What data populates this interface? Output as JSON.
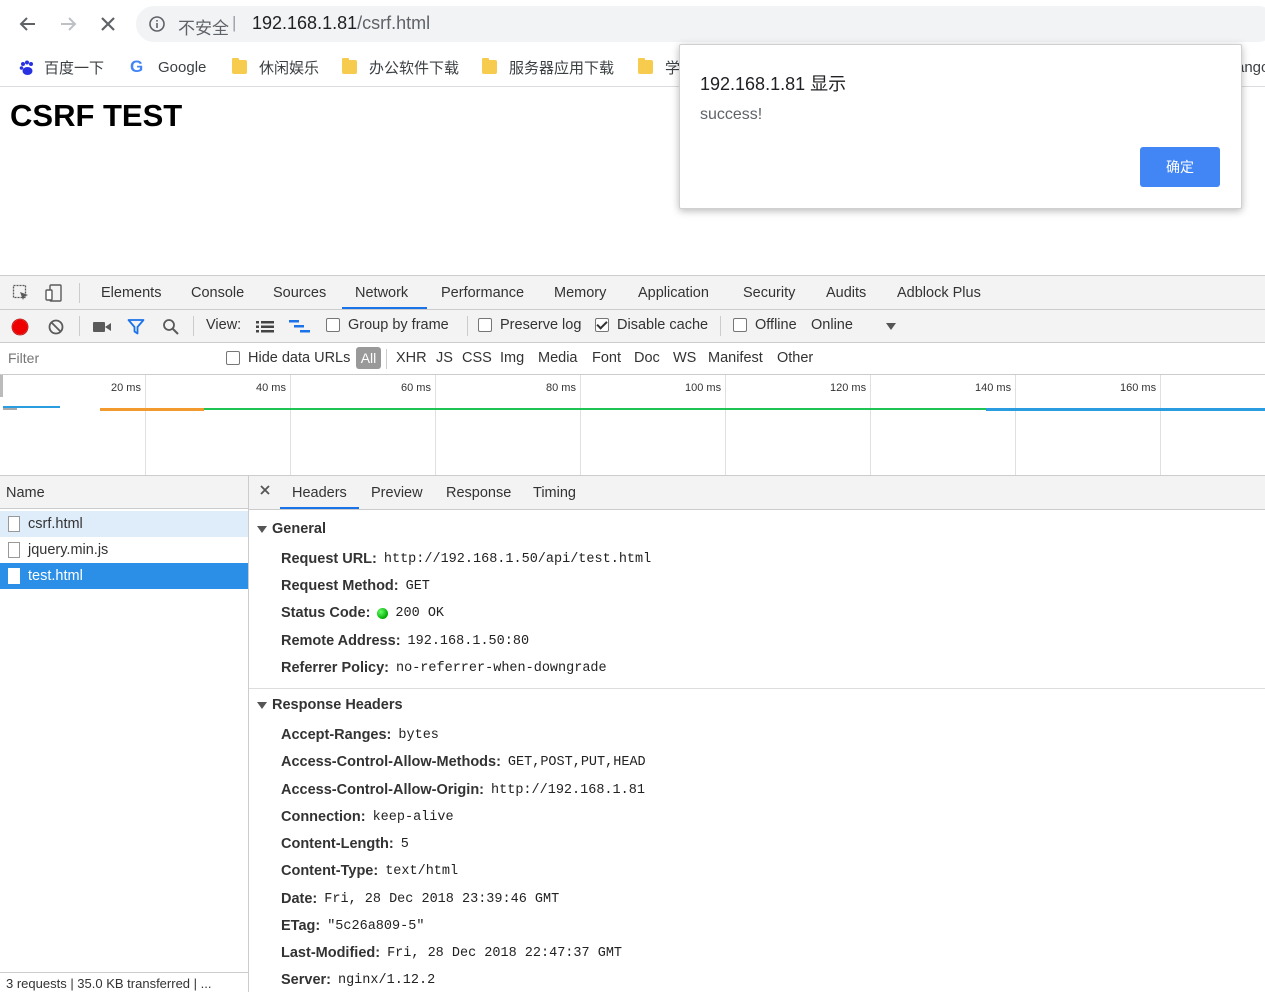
{
  "browser": {
    "security_label": "不安全",
    "separator": "|",
    "url_host": "192.168.1.81",
    "url_path": "/csrf.html",
    "bookmarks": [
      {
        "label": "百度一下",
        "icon": "baidu-paw-icon"
      },
      {
        "label": "Google",
        "icon": "google-g-icon"
      },
      {
        "label": "休闲娱乐",
        "icon": "folder-icon"
      },
      {
        "label": "办公软件下载",
        "icon": "folder-icon"
      },
      {
        "label": "服务器应用下载",
        "icon": "folder-icon"
      },
      {
        "label": "学",
        "icon": "folder-icon"
      },
      {
        "label": "ango",
        "icon": ""
      }
    ]
  },
  "page": {
    "heading": "CSRF TEST"
  },
  "alert": {
    "title": "192.168.1.81 显示",
    "message": "success!",
    "ok_label": "确定",
    "button_color": "#4285f4"
  },
  "devtools": {
    "tabs": [
      "Elements",
      "Console",
      "Sources",
      "Network",
      "Performance",
      "Memory",
      "Application",
      "Security",
      "Audits",
      "Adblock Plus"
    ],
    "active_tab": "Network",
    "toolbar": {
      "view_label": "View:",
      "group_by_frame": "Group by frame",
      "group_by_frame_checked": false,
      "preserve_log": "Preserve log",
      "preserve_log_checked": false,
      "disable_cache": "Disable cache",
      "disable_cache_checked": true,
      "offline": "Offline",
      "offline_checked": false,
      "throttle": "Online"
    },
    "filter": {
      "placeholder": "Filter",
      "hide_data_urls": "Hide data URLs",
      "types": [
        "All",
        "XHR",
        "JS",
        "CSS",
        "Img",
        "Media",
        "Font",
        "Doc",
        "WS",
        "Manifest",
        "Other"
      ],
      "active_type": "All"
    },
    "timeline": {
      "ticks": [
        "20 ms",
        "40 ms",
        "60 ms",
        "80 ms",
        "100 ms",
        "120 ms",
        "140 ms",
        "160 ms"
      ]
    },
    "name_column_header": "Name",
    "requests": [
      {
        "name": "csrf.html",
        "state": "highlighted"
      },
      {
        "name": "jquery.min.js",
        "state": "normal"
      },
      {
        "name": "test.html",
        "state": "selected"
      }
    ],
    "status_bar": "3 requests | 35.0 KB transferred | ...",
    "detail_tabs": [
      "Headers",
      "Preview",
      "Response",
      "Timing"
    ],
    "active_detail_tab": "Headers",
    "general_title": "General",
    "general": [
      {
        "key": "Request URL:",
        "value": "http://192.168.1.50/api/test.html"
      },
      {
        "key": "Request Method:",
        "value": "GET"
      },
      {
        "key": "Status Code:",
        "value": "200 OK",
        "status_color": "#00aa00"
      },
      {
        "key": "Remote Address:",
        "value": "192.168.1.50:80"
      },
      {
        "key": "Referrer Policy:",
        "value": "no-referrer-when-downgrade"
      }
    ],
    "response_headers_title": "Response Headers",
    "response_headers": [
      {
        "key": "Accept-Ranges:",
        "value": "bytes"
      },
      {
        "key": "Access-Control-Allow-Methods:",
        "value": "GET,POST,PUT,HEAD"
      },
      {
        "key": "Access-Control-Allow-Origin:",
        "value": "http://192.168.1.81"
      },
      {
        "key": "Connection:",
        "value": "keep-alive"
      },
      {
        "key": "Content-Length:",
        "value": "5"
      },
      {
        "key": "Content-Type:",
        "value": "text/html"
      },
      {
        "key": "Date:",
        "value": "Fri, 28 Dec 2018 23:39:46 GMT"
      },
      {
        "key": "ETag:",
        "value": "\"5c26a809-5\""
      },
      {
        "key": "Last-Modified:",
        "value": "Fri, 28 Dec 2018 22:47:37 GMT"
      },
      {
        "key": "Server:",
        "value": "nginx/1.12.2"
      }
    ],
    "accent_color": "#1a73e8"
  }
}
